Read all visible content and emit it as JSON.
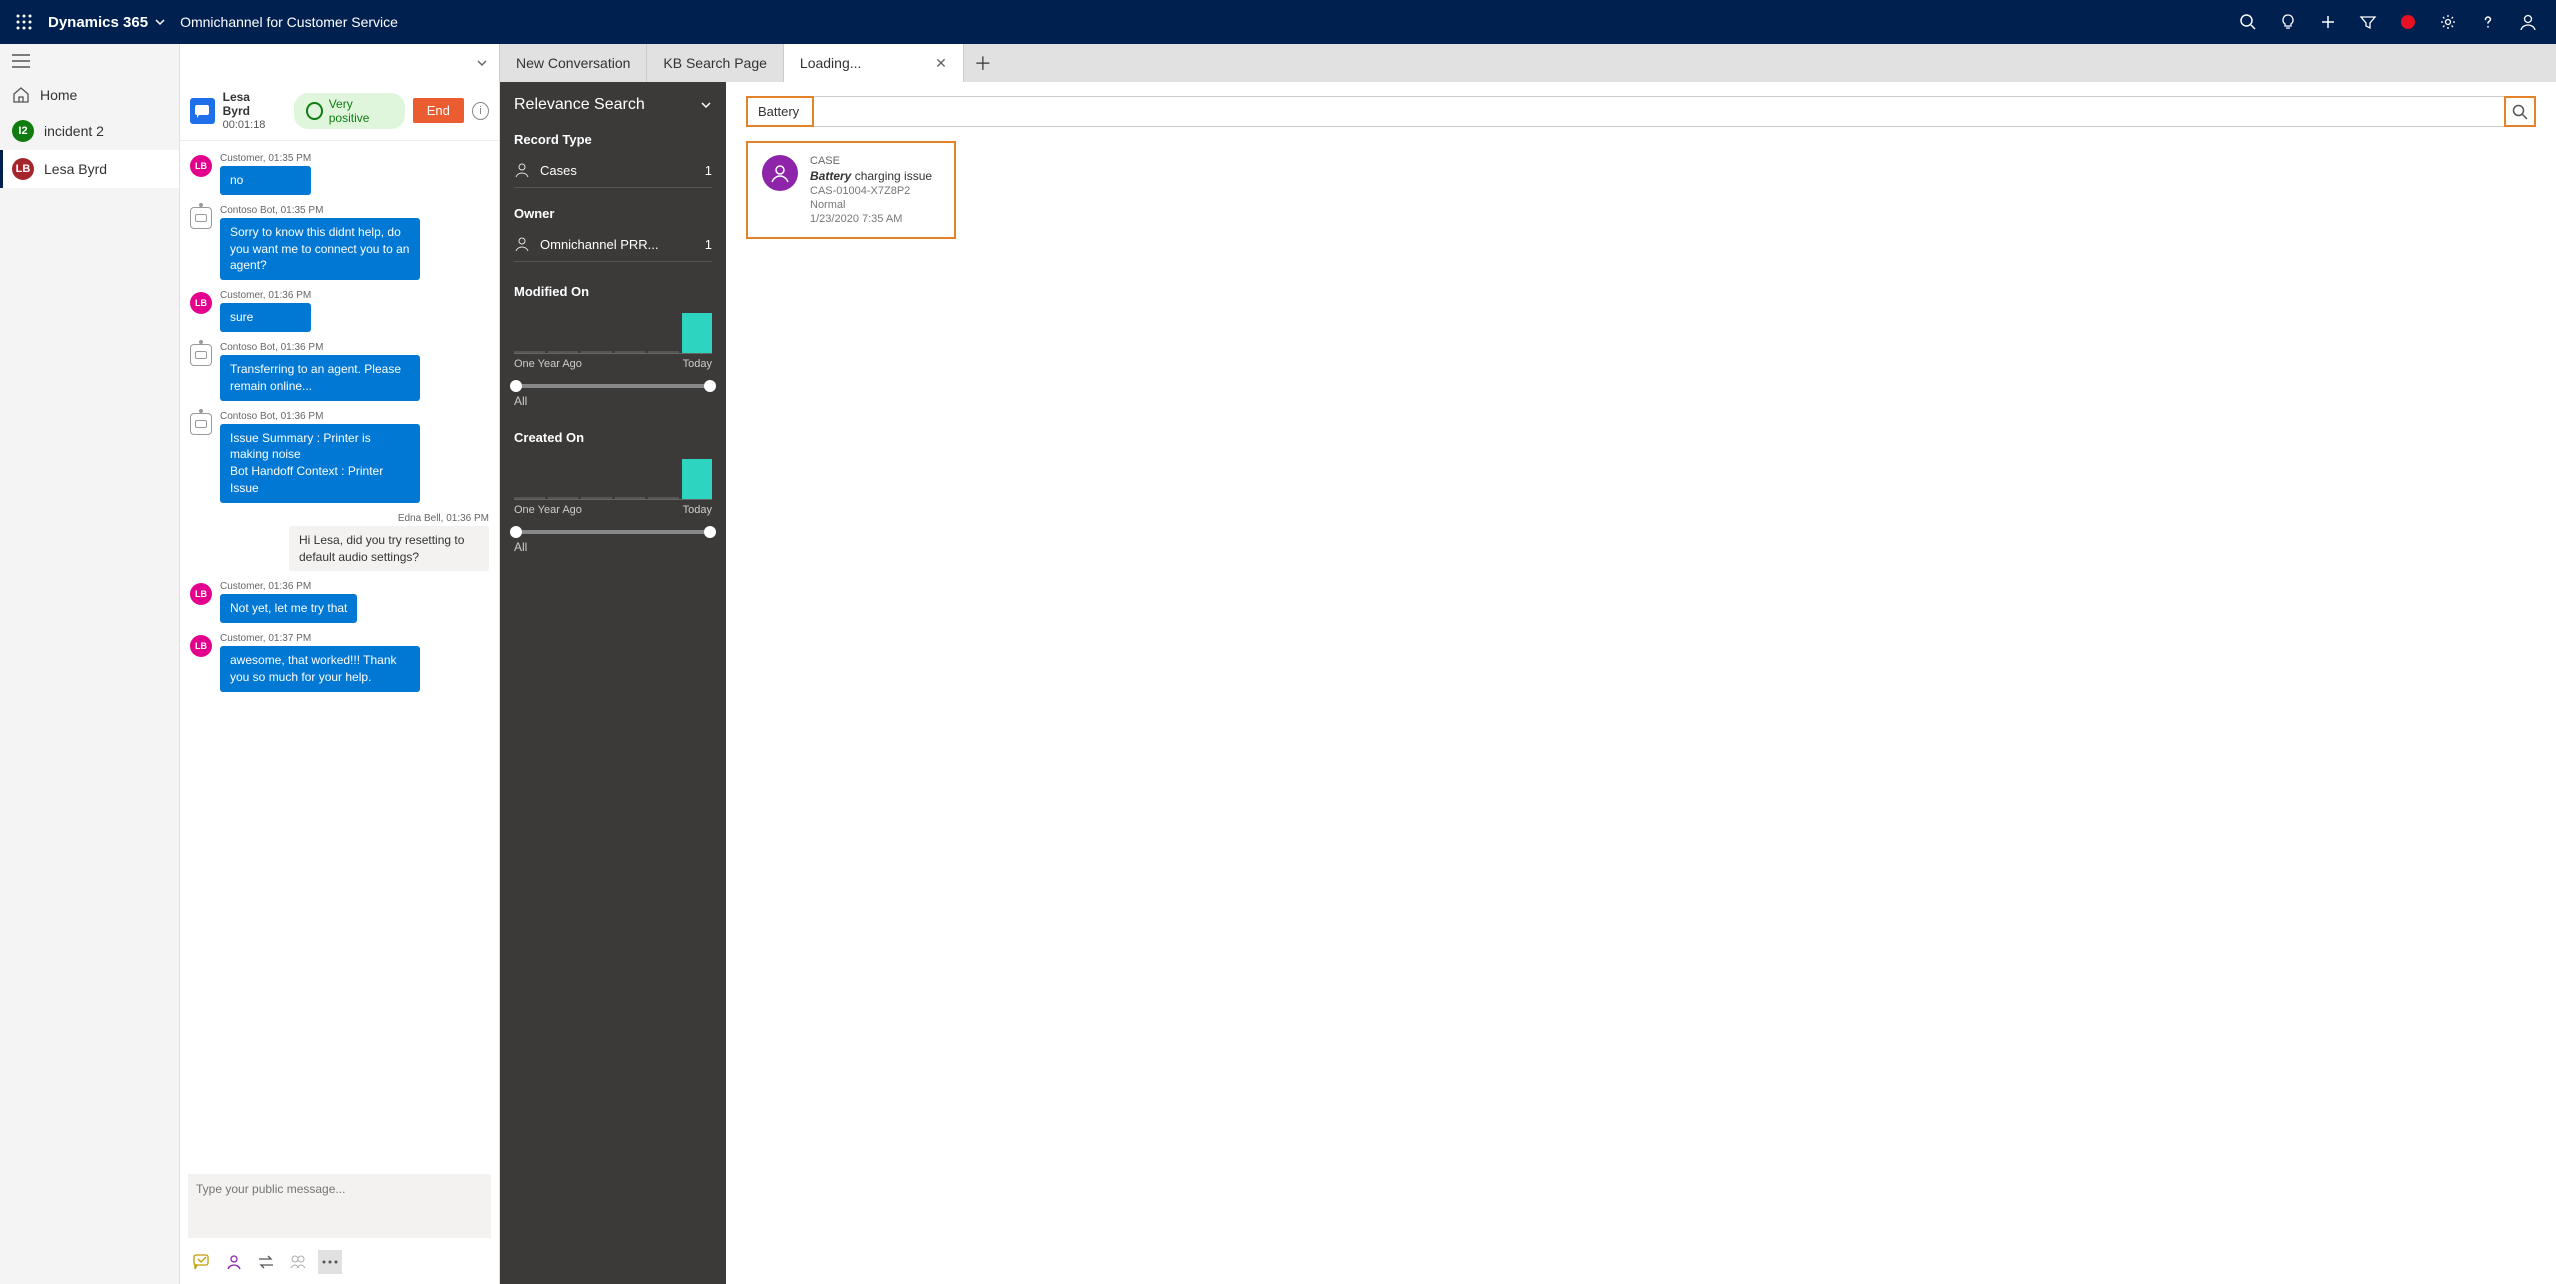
{
  "topbar": {
    "app_name": "Dynamics 365",
    "subtitle": "Omnichannel for Customer Service"
  },
  "leftnav": {
    "home": "Home",
    "incident": {
      "badge": "I2",
      "label": "incident 2"
    },
    "session": {
      "badge": "LB",
      "label": "Lesa Byrd"
    }
  },
  "tabs": {
    "new_conv": "New Conversation",
    "kb_search": "KB Search Page",
    "loading": "Loading..."
  },
  "chat_header": {
    "name": "Lesa Byrd",
    "timer": "00:01:18",
    "sentiment": "Very positive",
    "end": "End"
  },
  "chat": [
    {
      "who": "Customer",
      "time": "01:35 PM",
      "avatar": "LB",
      "avtype": "pink",
      "text": "no"
    },
    {
      "who": "Contoso Bot",
      "time": "01:35 PM",
      "avtype": "bot",
      "text": "Sorry to know this didnt help, do you want me to connect you to an agent?"
    },
    {
      "who": "Customer",
      "time": "01:36 PM",
      "avatar": "LB",
      "avtype": "pink",
      "text": "sure"
    },
    {
      "who": "Contoso Bot",
      "time": "01:36 PM",
      "avtype": "bot",
      "text": "Transferring to an agent. Please remain online..."
    },
    {
      "who": "Contoso Bot",
      "time": "01:36 PM",
      "avtype": "bot",
      "text": "Issue Summary : Printer is making noise\nBot Handoff Context : Printer Issue"
    },
    {
      "agent": "Edna Bell",
      "time": "01:36 PM",
      "text": "Hi Lesa, did you try resetting to default audio settings?",
      "light": true
    },
    {
      "who": "Customer",
      "time": "01:36 PM",
      "avatar": "LB",
      "avtype": "pink",
      "text": "Not yet, let me try that"
    },
    {
      "who": "Customer",
      "time": "01:37 PM",
      "avatar": "LB",
      "avtype": "pink",
      "text": "awesome, that worked!!! Thank you so much for your help."
    }
  ],
  "chat_input": {
    "placeholder": "Type your public message..."
  },
  "relevance": {
    "title": "Relevance Search",
    "record_type": "Record Type",
    "cases": {
      "label": "Cases",
      "count": "1"
    },
    "owner_section": "Owner",
    "owner": {
      "label": "Omnichannel PRR...",
      "count": "1"
    },
    "modified_on": "Modified On",
    "created_on": "Created On",
    "axis_left": "One Year Ago",
    "axis_right": "Today",
    "all": "All"
  },
  "search": {
    "query": "Battery",
    "result": {
      "type": "CASE",
      "title_bold": "Battery",
      "title_rest": " charging issue",
      "case_num": "CAS-01004-X7Z8P2",
      "priority": "Normal",
      "date": "1/23/2020 7:35 AM"
    }
  },
  "chart_data": [
    {
      "type": "bar",
      "title": "Modified On",
      "categories": [
        "One Year Ago",
        "",
        "",
        "",
        "",
        "Today"
      ],
      "values": [
        0,
        0,
        0,
        0,
        0,
        1
      ],
      "xlabel": "",
      "ylabel": "",
      "ylim": [
        0,
        1
      ]
    },
    {
      "type": "bar",
      "title": "Created On",
      "categories": [
        "One Year Ago",
        "",
        "",
        "",
        "",
        "Today"
      ],
      "values": [
        0,
        0,
        0,
        0,
        0,
        1
      ],
      "xlabel": "",
      "ylabel": "",
      "ylim": [
        0,
        1
      ]
    }
  ]
}
